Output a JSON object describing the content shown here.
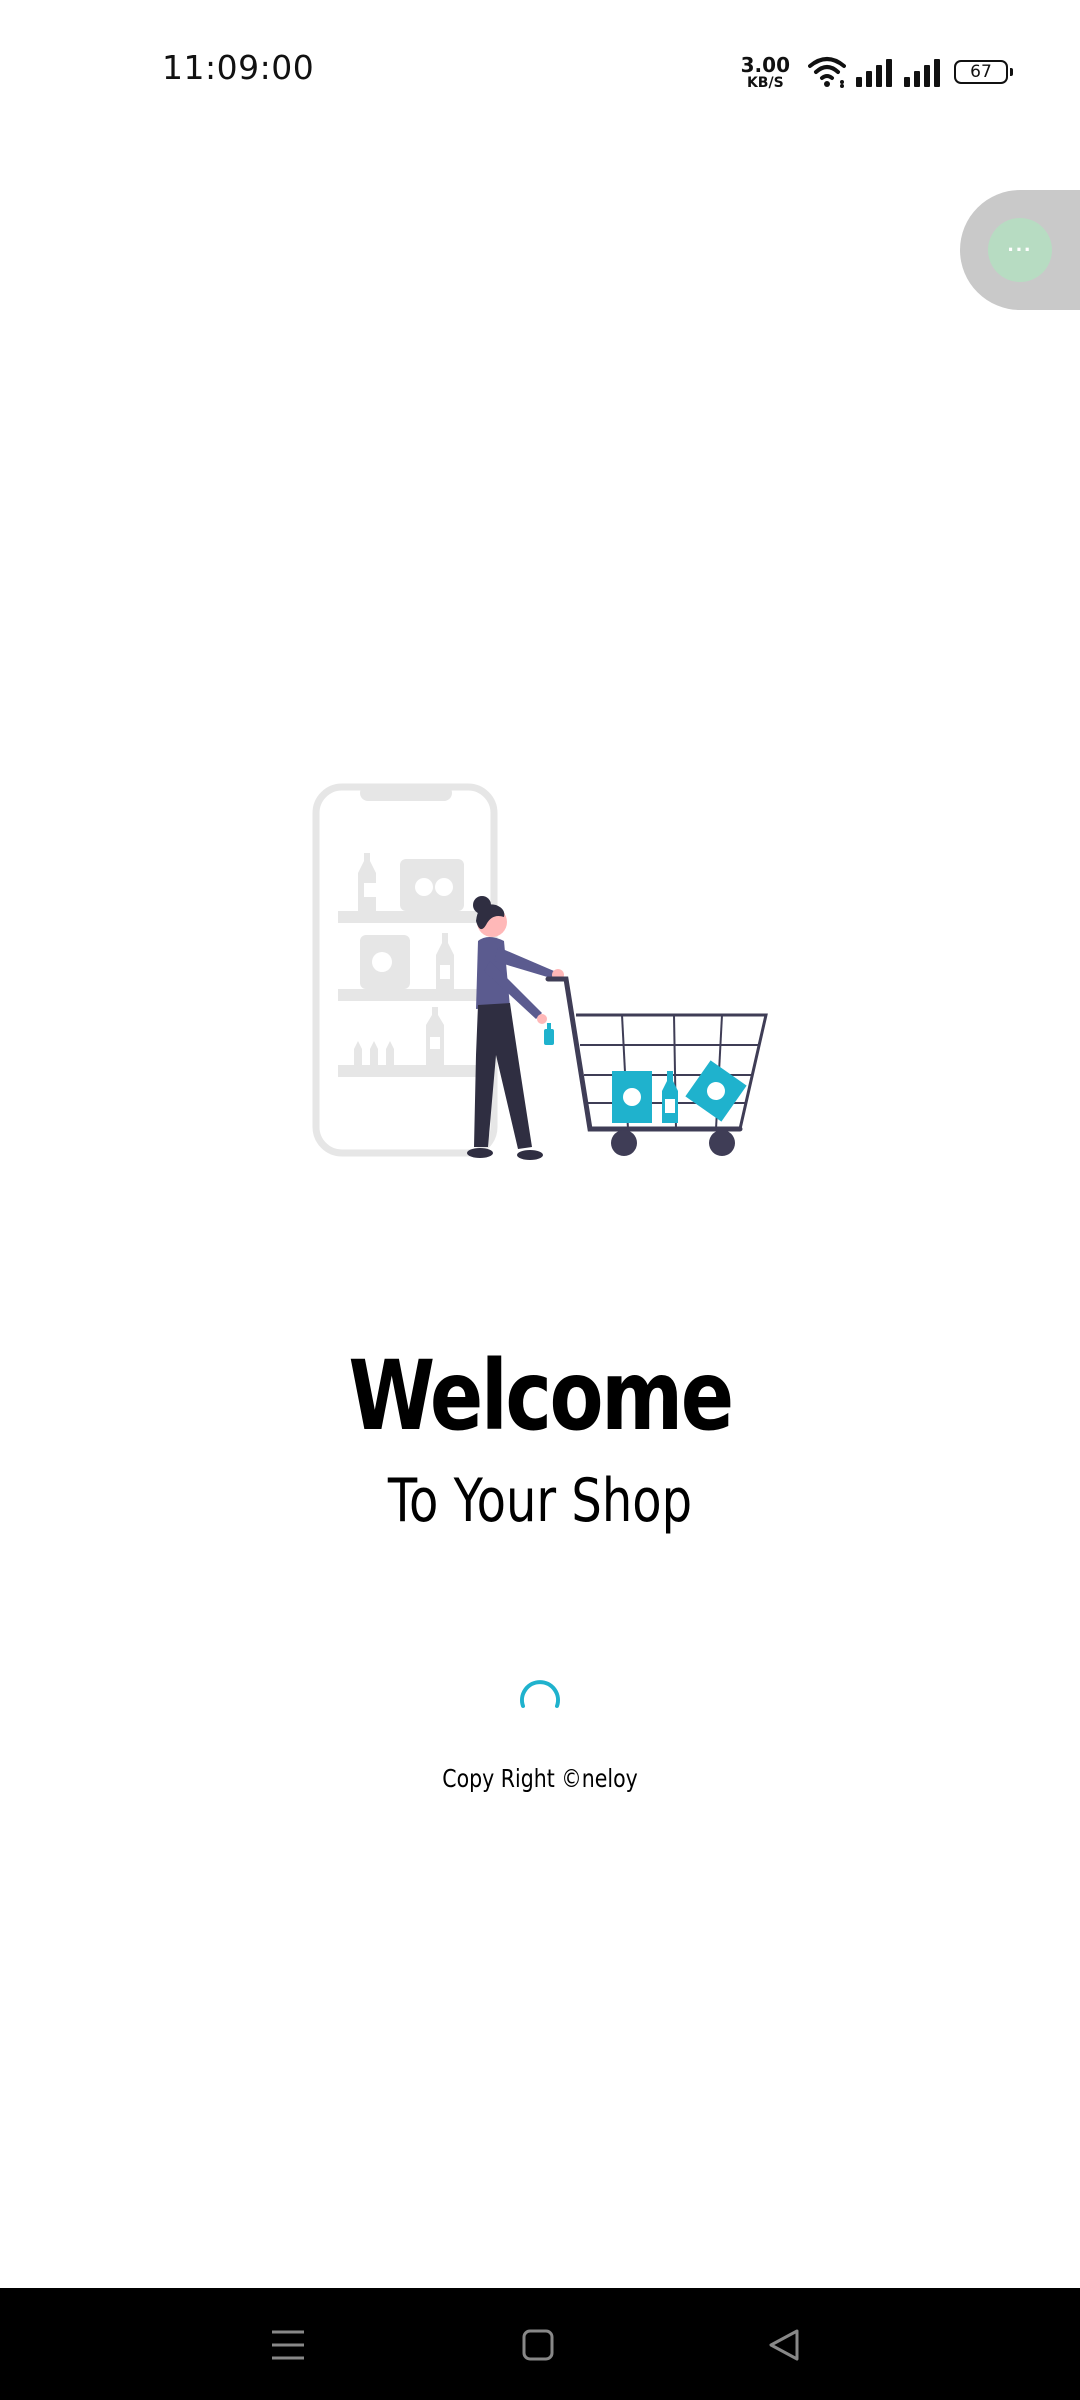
{
  "status_bar": {
    "time": "11:09:00",
    "speed_value": "3.00",
    "speed_unit": "KB/S",
    "battery": "67"
  },
  "floating_bubble": {
    "label": "···"
  },
  "welcome": {
    "title": "Welcome",
    "subtitle": "To Your Shop"
  },
  "footer": {
    "copyright": "Copy Right ©neloy"
  },
  "icons": {
    "wifi": "wifi-icon",
    "signal": "signal-icon",
    "battery": "battery-icon",
    "menu": "menu-icon",
    "home": "home-icon",
    "back": "back-icon"
  },
  "colors": {
    "accent": "#1fb2cd",
    "figure": "#5b5b8f",
    "dark": "#2f2e41",
    "phone_gray": "#e6e6e6",
    "bubble_bg": "#c9c9c9",
    "bubble_inner": "#b7dcc2"
  }
}
